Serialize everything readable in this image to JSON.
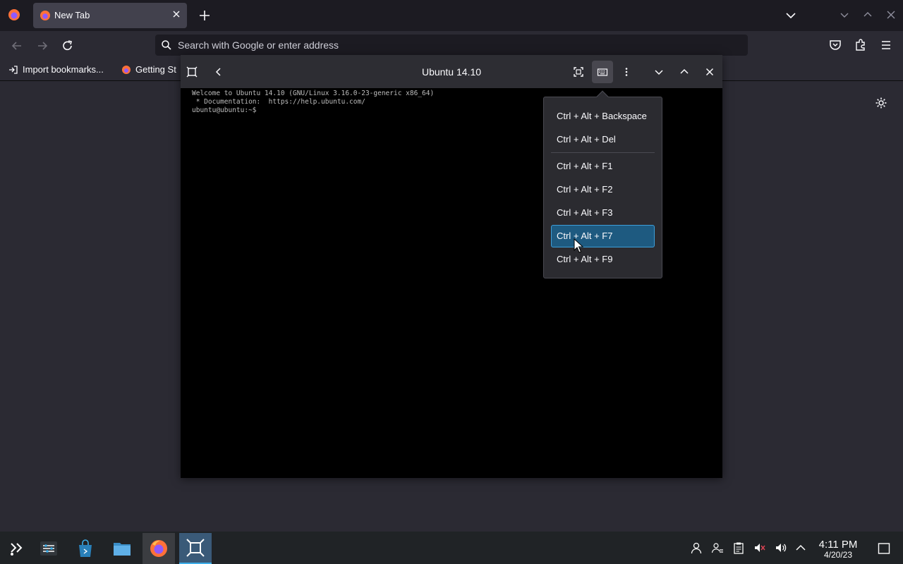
{
  "browser": {
    "tab": {
      "title": "New Tab"
    },
    "urlbar": {
      "placeholder": "Search with Google or enter address"
    },
    "bookmarks": [
      {
        "label": "Import bookmarks..."
      },
      {
        "label": "Getting St"
      }
    ]
  },
  "vm": {
    "title": "Ubuntu 14.10",
    "terminal_lines": [
      "Welcome to Ubuntu 14.10 (GNU/Linux 3.16.0-23-generic x86_64)",
      "",
      " * Documentation:  https://help.ubuntu.com/",
      "",
      "",
      "ubuntu@ubuntu:~$"
    ]
  },
  "keys_menu": {
    "items": [
      {
        "label": "Ctrl + Alt + Backspace"
      },
      {
        "label": "Ctrl + Alt + Del"
      },
      {
        "label": "Ctrl + Alt + F1"
      },
      {
        "label": "Ctrl + Alt + F2"
      },
      {
        "label": "Ctrl + Alt + F3"
      },
      {
        "label": "Ctrl + Alt + F7",
        "selected": true
      },
      {
        "label": "Ctrl + Alt + F9"
      }
    ]
  },
  "taskbar": {
    "clock": {
      "time": "4:11 PM",
      "date": "4/20/23"
    }
  },
  "colors": {
    "accent": "#3daee9",
    "selected_bg": "#1e5a80",
    "firefox_orange": "#ff7139"
  }
}
